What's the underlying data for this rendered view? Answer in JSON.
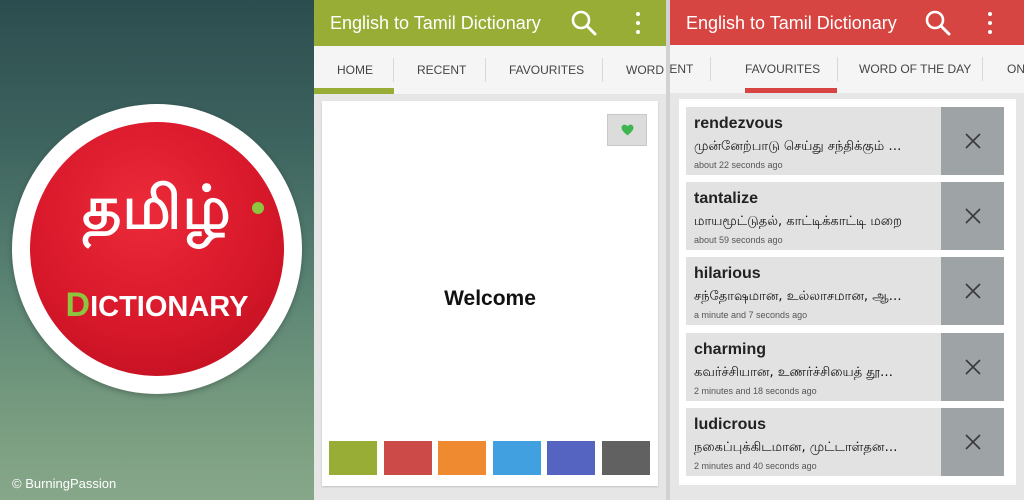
{
  "promo": {
    "logo_tamil": "தமிழ்",
    "logo_dict_first": "D",
    "logo_dict_rest": "ICTIONARY",
    "copyright": "© BurningPassion",
    "colors": {
      "disc": "#d7182a",
      "accent_green": "#8cc63f"
    }
  },
  "screen_home": {
    "app_title": "English to Tamil Dictionary",
    "accent": "#97ad36",
    "icons": {
      "search": "search-icon",
      "menu": "overflow-menu-icon",
      "favourite": "heart-icon"
    },
    "tabs": [
      "HOME",
      "RECENT",
      "FAVOURITES",
      "WORD OF THE DAY"
    ],
    "selected_tab": "HOME",
    "welcome": "Welcome",
    "swatches": [
      "#97ad36",
      "#cc4a47",
      "#f08a30",
      "#40a0e0",
      "#5563c1",
      "#616161"
    ]
  },
  "screen_favourites": {
    "app_title": "English to Tamil Dictionary",
    "accent": "#d64541",
    "icons": {
      "search": "search-icon",
      "menu": "overflow-menu-icon",
      "remove": "close-icon"
    },
    "tabs": [
      "RECENT",
      "FAVOURITES",
      "WORD OF THE DAY",
      "ON"
    ],
    "selected_tab": "FAVOURITES",
    "items": [
      {
        "word": "rendezvous",
        "meaning": "முன்னேற்பாடு செய்து சந்திக்கும் …",
        "time": "about 22 seconds ago"
      },
      {
        "word": "tantalize",
        "meaning": "மாயமூட்டுதல், காட்டிக்காட்டி மறை",
        "time": "about 59 seconds ago"
      },
      {
        "word": "hilarious",
        "meaning": "சந்தோஷமான, உல்லாசமான, ஆ…",
        "time": "a minute and 7 seconds ago"
      },
      {
        "word": "charming",
        "meaning": "கவர்ச்சியான, உணர்ச்சியைத் தூ…",
        "time": "2 minutes and 18 seconds ago"
      },
      {
        "word": "ludicrous",
        "meaning": "நகைப்புக்கிடமான, முட்டாள்தன…",
        "time": "2 minutes and 40 seconds ago"
      }
    ]
  }
}
